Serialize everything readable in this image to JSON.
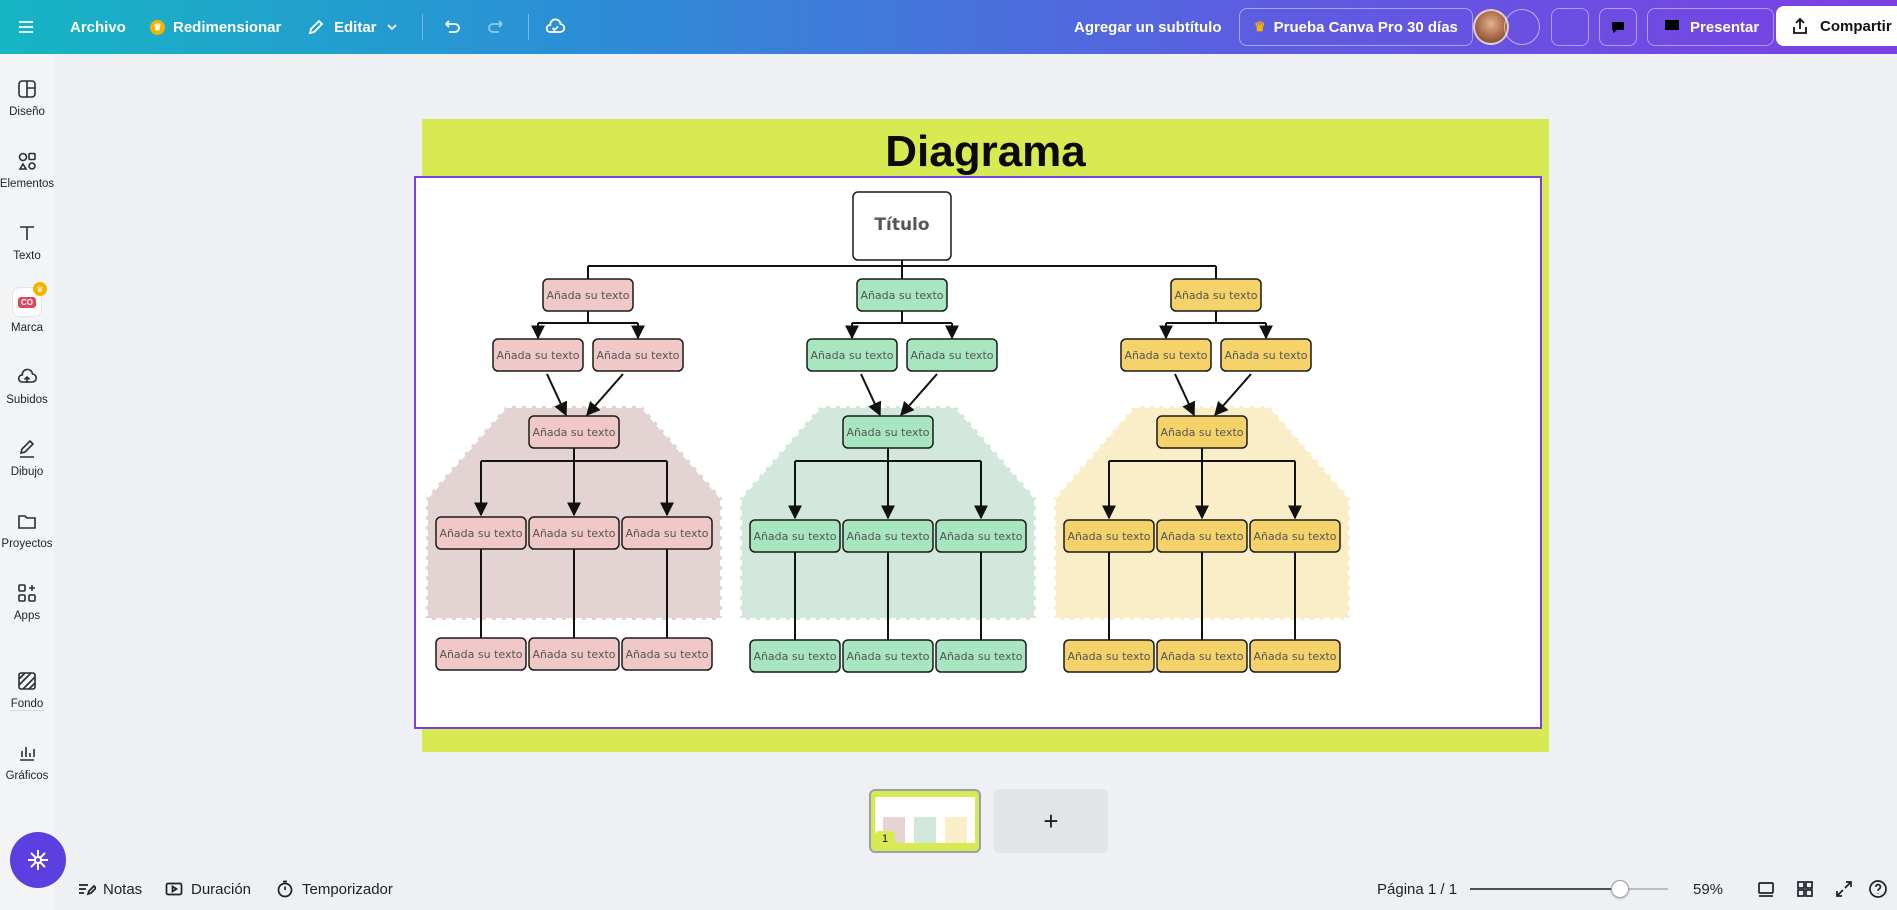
{
  "header": {
    "menu_icon": "hamburger-icon",
    "file_label": "Archivo",
    "resize_label": "Redimensionar",
    "edit_label": "Editar",
    "subtitle_label": "Agregar un subtítulo",
    "pro_label": "Prueba Canva Pro 30 días",
    "present_label": "Presentar",
    "share_label": "Compartir"
  },
  "sidebar": {
    "items": [
      {
        "label": "Diseño",
        "icon": "layout-icon"
      },
      {
        "label": "Elementos",
        "icon": "shapes-icon"
      },
      {
        "label": "Texto",
        "icon": "text-icon"
      },
      {
        "label": "Marca",
        "icon": "brand-icon",
        "badge": "CO"
      },
      {
        "label": "Subidos",
        "icon": "cloud-upload-icon"
      },
      {
        "label": "Dibujo",
        "icon": "pen-icon"
      },
      {
        "label": "Proyectos",
        "icon": "folder-icon"
      },
      {
        "label": "Apps",
        "icon": "apps-icon"
      },
      {
        "label": "Fondo",
        "icon": "background-icon"
      },
      {
        "label": "Gráficos",
        "icon": "chart-icon"
      }
    ]
  },
  "canvas": {
    "title": "Diagrama",
    "root_label": "Título",
    "node_label": "Añada su texto",
    "colors": {
      "page_bg": "#d7ea52",
      "pink": "#f0c8c8",
      "green": "#a8e6bf",
      "yellow": "#f5d36a",
      "pink_zone": "#e3d3d3",
      "green_zone": "#d3e8dc",
      "yellow_zone": "#faeec8",
      "selection": "#7b3fe4"
    }
  },
  "pages": {
    "thumb_number": "1",
    "add_symbol": "+"
  },
  "bottom": {
    "notes_label": "Notas",
    "duration_label": "Duración",
    "timer_label": "Temporizador",
    "page_indicator": "Página 1 / 1",
    "zoom_label": "59%",
    "zoom_fraction": 0.59
  }
}
